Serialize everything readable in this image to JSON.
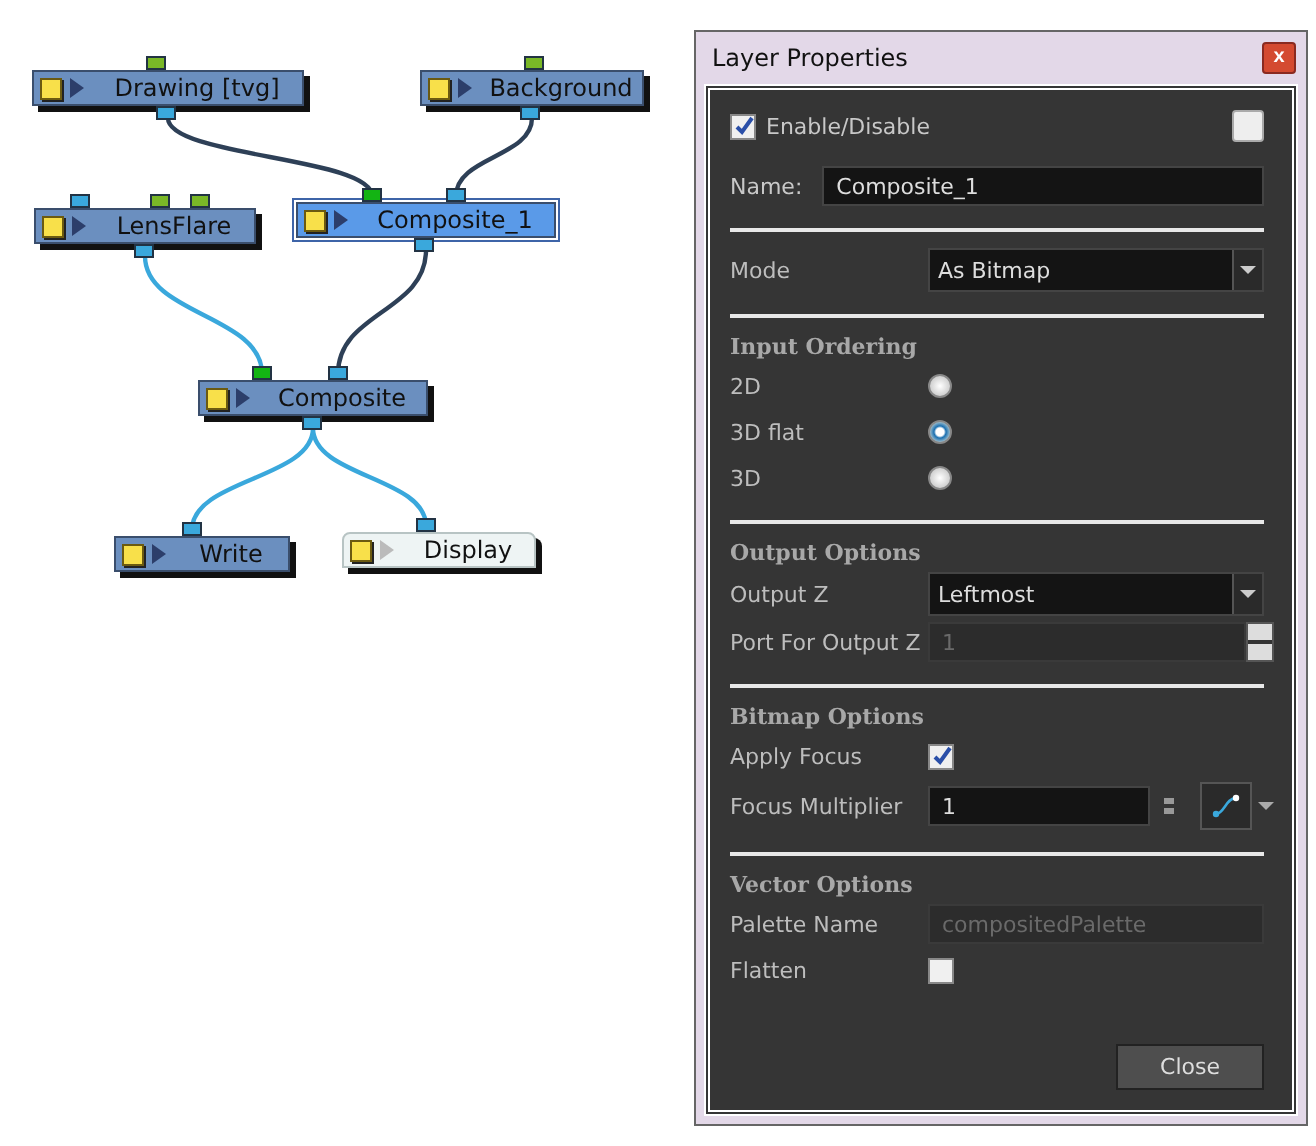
{
  "node_graph": {
    "nodes": [
      {
        "label": "Drawing  [tvg]",
        "kind": "normal",
        "selected": false,
        "inputs": [
          {
            "color": "#7ab827"
          }
        ]
      },
      {
        "label": "Background",
        "kind": "normal",
        "selected": false,
        "inputs": [
          {
            "color": "#7ab827"
          }
        ]
      },
      {
        "label": "LensFlare",
        "kind": "normal",
        "selected": false,
        "inputs": [
          {
            "color": "#3aa8dc"
          },
          {
            "color": "#7ab827"
          },
          {
            "color": "#7ab827"
          }
        ]
      },
      {
        "label": "Composite_1",
        "kind": "normal",
        "selected": true,
        "inputs": [
          {
            "color": "#13b413"
          },
          {
            "color": "#3aa8dc"
          }
        ]
      },
      {
        "label": "Composite",
        "kind": "normal",
        "selected": false,
        "inputs": [
          {
            "color": "#13b413"
          },
          {
            "color": "#3aa8dc"
          }
        ]
      },
      {
        "label": "Write",
        "kind": "normal",
        "selected": false,
        "inputs": [
          {
            "color": "#3aa8dc"
          }
        ]
      },
      {
        "label": "Display",
        "kind": "display",
        "selected": false,
        "inputs": [
          {
            "color": "#3aa8dc"
          }
        ]
      }
    ],
    "edges": [
      {
        "color": "#2e4057"
      },
      {
        "color": "#2e4057"
      },
      {
        "color": "#3aa8dc"
      },
      {
        "color": "#2e4057"
      },
      {
        "color": "#3aa8dc"
      },
      {
        "color": "#3aa8dc"
      }
    ]
  },
  "dialog": {
    "title": "Layer Properties",
    "close": "x",
    "enable": {
      "label": "Enable/Disable",
      "checked": true
    },
    "name": {
      "label": "Name:",
      "value": "Composite_1"
    },
    "sections": [
      {
        "rows": [
          {
            "kind": "select",
            "label": "Mode",
            "value": "As Bitmap"
          }
        ]
      },
      {
        "title": "Input Ordering",
        "rows": [
          {
            "kind": "radio",
            "label": "2D",
            "selected": false
          },
          {
            "kind": "radio",
            "label": "3D flat",
            "selected": true
          },
          {
            "kind": "radio",
            "label": "3D",
            "selected": false
          }
        ]
      },
      {
        "title": "Output Options",
        "rows": [
          {
            "kind": "select",
            "label": "Output Z",
            "value": "Leftmost"
          },
          {
            "kind": "spin",
            "label": "Port For Output Z",
            "value": "1",
            "disabled": true
          }
        ]
      },
      {
        "title": "Bitmap Options",
        "rows": [
          {
            "kind": "checkbox",
            "label": "Apply Focus",
            "checked": true
          },
          {
            "kind": "number",
            "label": "Focus Multiplier",
            "value": "1"
          }
        ]
      },
      {
        "title": "Vector Options",
        "rows": [
          {
            "kind": "text",
            "label": "Palette Name",
            "value": "compositedPalette",
            "disabled": true
          },
          {
            "kind": "checkbox",
            "label": "Flatten",
            "checked": false
          }
        ]
      }
    ],
    "button": "Close"
  }
}
